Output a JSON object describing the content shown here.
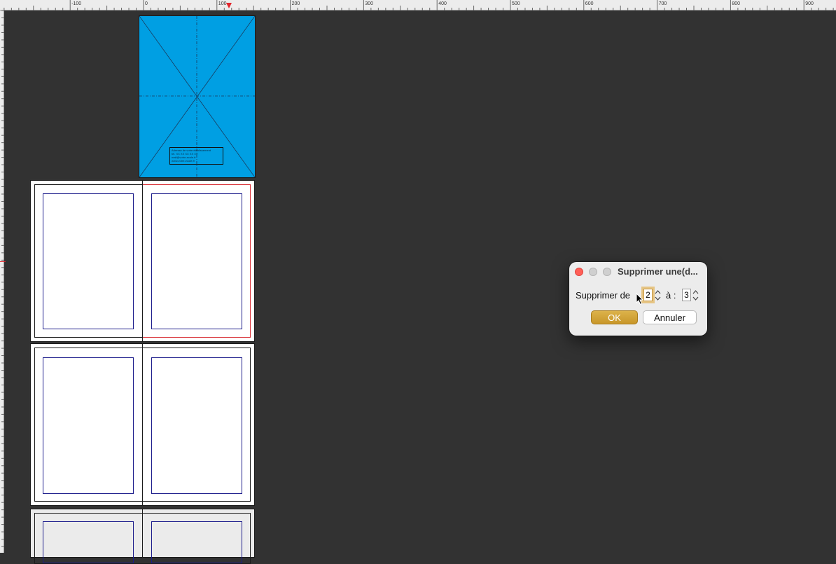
{
  "ruler": {
    "labels": [
      "-100",
      "0",
      "100",
      "200",
      "300",
      "400",
      "500",
      "600",
      "700",
      "800",
      "900"
    ]
  },
  "cover": {
    "text_block_lines": [
      "Adresse de votre établissement",
      "tel. XX XX XX XX XX",
      "mail@votre-ecole.fr",
      "www.votre-ecole.fr"
    ]
  },
  "dialog": {
    "title": "Supprimer une(d...",
    "from_label": "Supprimer de",
    "from_value": "2",
    "to_label": "à :",
    "to_value": "3",
    "ok_label": "OK",
    "cancel_label": "Annuler"
  },
  "colors": {
    "canvas": "#323232",
    "cover": "#009fe3",
    "margin_guides": "#1d1d8c",
    "bleed_red": "#d9343a",
    "ok_button": "#c8972a"
  }
}
